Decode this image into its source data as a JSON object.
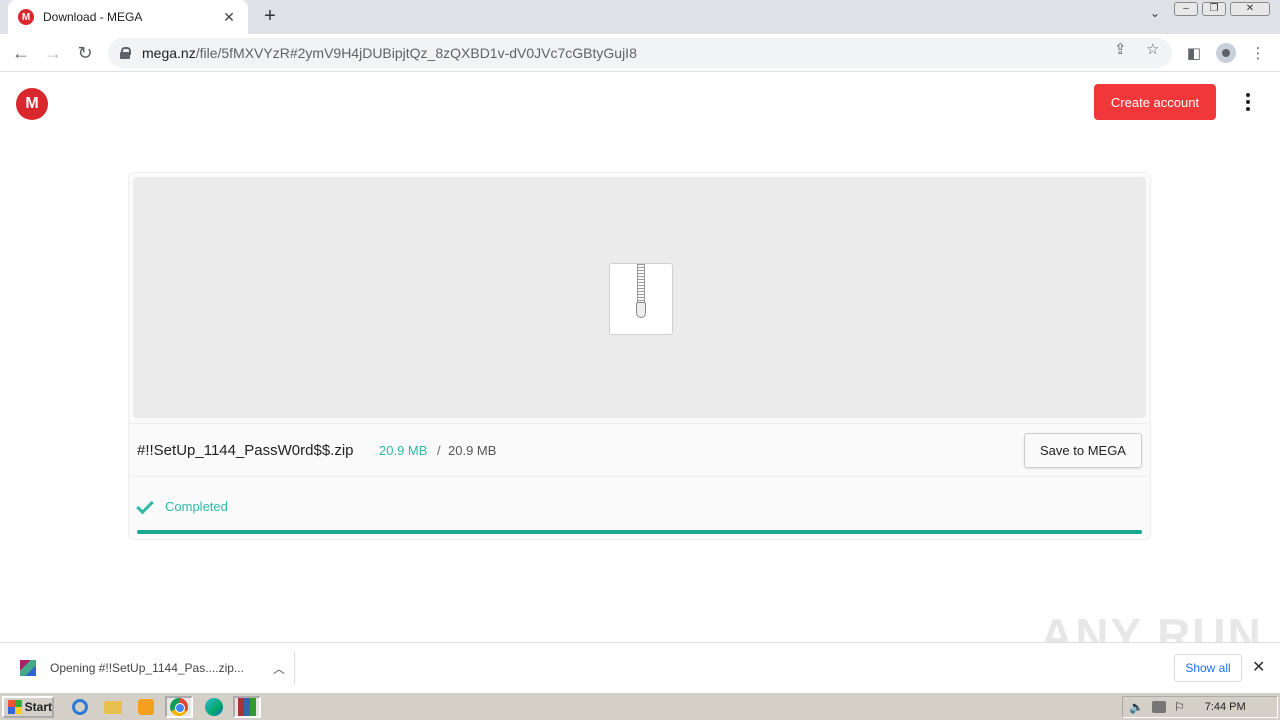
{
  "browser": {
    "tab_title": "Download - MEGA",
    "tab_favicon_letter": "M",
    "url_host": "mega.nz",
    "url_path": "/file/5fMXVYzR#2ymV9H4jDUBipjtQz_8zQXBD1v-dV0JVc7cGBtyGujI8"
  },
  "page": {
    "logo_letter": "M",
    "create_account_label": "Create account",
    "file": {
      "name": "#!!SetUp_1144_PassW0rd$$.zip",
      "downloaded": "20.9 MB",
      "separator": "/",
      "total": "20.9 MB",
      "save_label": "Save to MEGA",
      "status": "Completed",
      "progress_percent": 100
    },
    "colors": {
      "accent": "#31b9a6",
      "brand_red": "#d9272e",
      "button_red": "#f0373a"
    }
  },
  "download_shelf": {
    "item_text": "Opening #!!SetUp_1144_Pas....zip...",
    "show_all_label": "Show all",
    "watermark": "ANY RUN"
  },
  "taskbar": {
    "start_label": "Start",
    "clock": "7:44 PM"
  }
}
